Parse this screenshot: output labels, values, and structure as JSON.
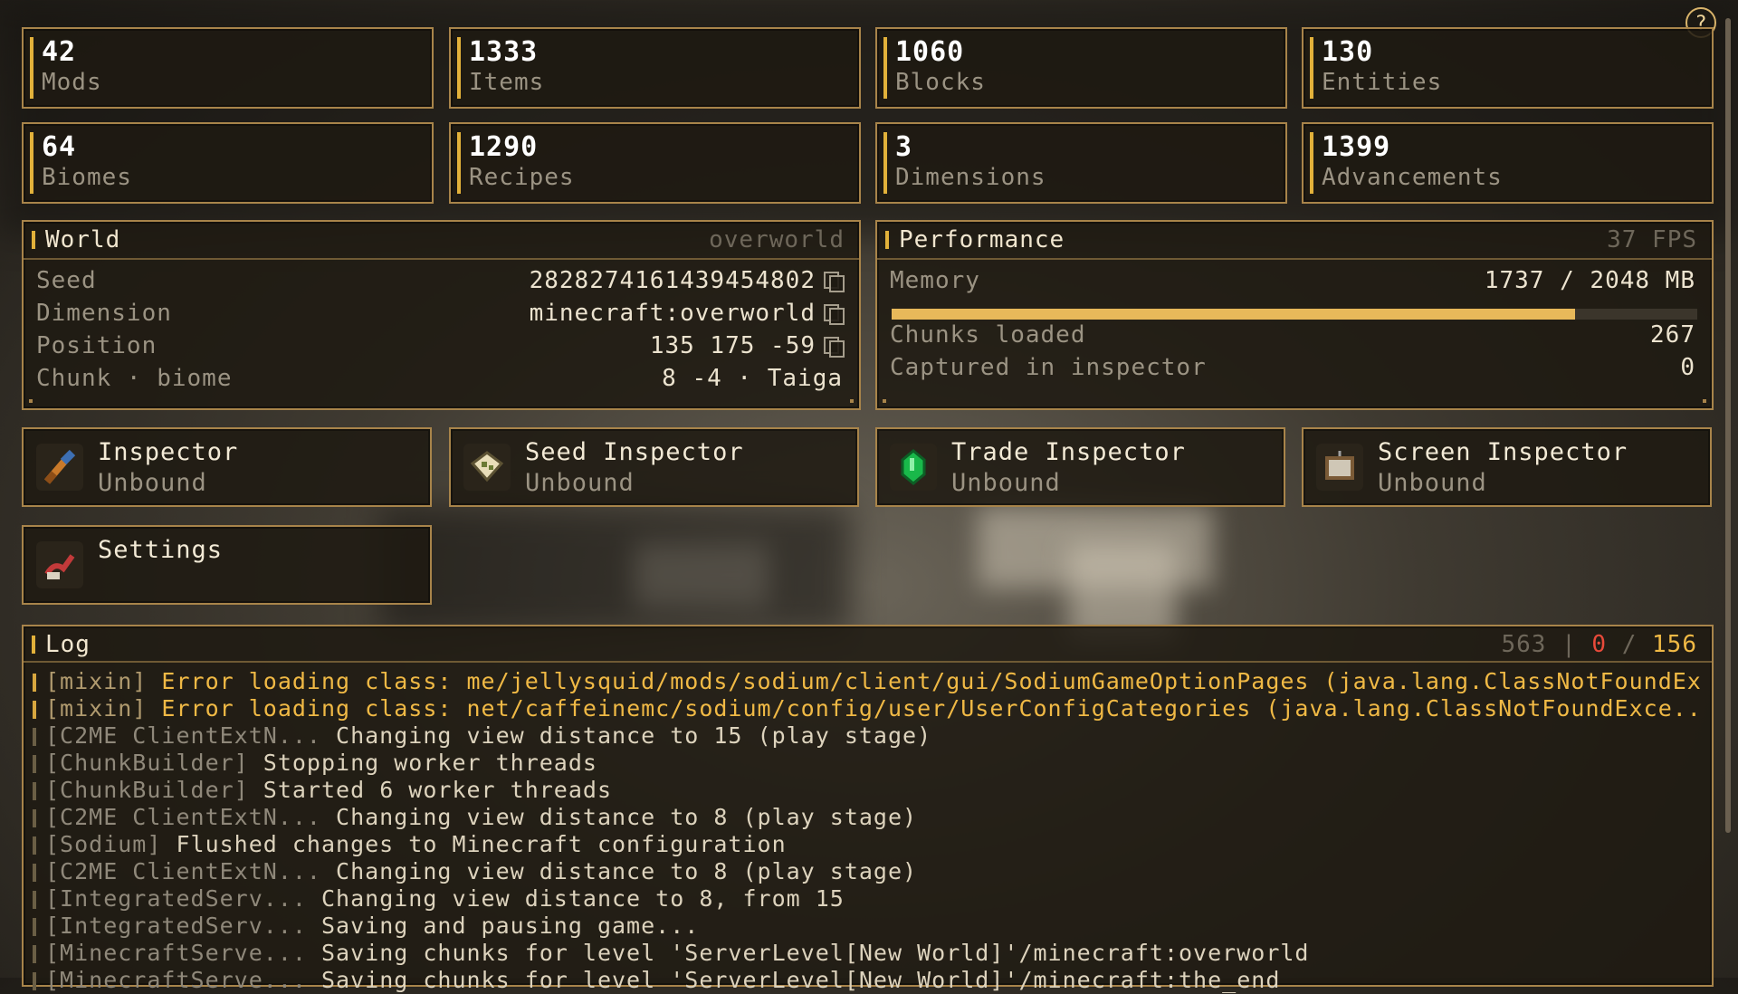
{
  "stats": [
    {
      "value": "42",
      "label": "Mods"
    },
    {
      "value": "1333",
      "label": "Items"
    },
    {
      "value": "1060",
      "label": "Blocks"
    },
    {
      "value": "130",
      "label": "Entities"
    },
    {
      "value": "64",
      "label": "Biomes"
    },
    {
      "value": "1290",
      "label": "Recipes"
    },
    {
      "value": "3",
      "label": "Dimensions"
    },
    {
      "value": "1399",
      "label": "Advancements"
    }
  ],
  "world": {
    "title": "World",
    "dimension_tag": "overworld",
    "rows": [
      {
        "key": "Seed",
        "value": "2828274161439454802"
      },
      {
        "key": "Dimension",
        "value": "minecraft:overworld"
      },
      {
        "key": "Position",
        "value": "135 175 -59"
      },
      {
        "key": "Chunk · biome",
        "value": "8 -4 · Taiga"
      }
    ]
  },
  "performance": {
    "title": "Performance",
    "fps": "37 FPS",
    "memory_label": "Memory",
    "memory_value": "1737 / 2048 MB",
    "memory_fraction": 0.848,
    "chunks_label": "Chunks loaded",
    "chunks_value": "267",
    "captured_label": "Captured in inspector",
    "captured_value": "0"
  },
  "tools": [
    {
      "name": "Inspector",
      "binding": "Unbound",
      "icon": "spyglass-icon"
    },
    {
      "name": "Seed Inspector",
      "binding": "Unbound",
      "icon": "map-icon"
    },
    {
      "name": "Trade Inspector",
      "binding": "Unbound",
      "icon": "emerald-icon"
    },
    {
      "name": "Screen Inspector",
      "binding": "Unbound",
      "icon": "painting-icon"
    },
    {
      "name": "Settings",
      "binding": "",
      "icon": "settings-icon"
    }
  ],
  "log": {
    "title": "Log",
    "total": "563",
    "separator": "|",
    "errors": "0",
    "slash": "/",
    "warnings": "156",
    "colors": {
      "errors": "#e84a3a",
      "warnings": "#f0b945"
    },
    "lines": [
      {
        "level": "warn",
        "source": "[mixin]",
        "text": "Error loading class: me/jellysquid/mods/sodium/client/gui/SodiumGameOptionPages (java.lang.ClassNotFoundEx..."
      },
      {
        "level": "warn",
        "source": "[mixin]",
        "text": "Error loading class: net/caffeinemc/sodium/config/user/UserConfigCategories (java.lang.ClassNotFoundExce..."
      },
      {
        "level": "info",
        "source": "[C2ME ClientExtN...",
        "text": "Changing view distance to 15 (play stage)"
      },
      {
        "level": "info",
        "source": "[ChunkBuilder]",
        "text": "Stopping worker threads"
      },
      {
        "level": "info",
        "source": "[ChunkBuilder]",
        "text": "Started 6 worker threads"
      },
      {
        "level": "info",
        "source": "[C2ME ClientExtN...",
        "text": "Changing view distance to 8 (play stage)"
      },
      {
        "level": "info",
        "source": "[Sodium]",
        "text": "Flushed changes to Minecraft configuration"
      },
      {
        "level": "info",
        "source": "[C2ME ClientExtN...",
        "text": "Changing view distance to 8 (play stage)"
      },
      {
        "level": "info",
        "source": "[IntegratedServ...",
        "text": "Changing view distance to 8, from 15"
      },
      {
        "level": "info",
        "source": "[IntegratedServ...",
        "text": "Saving and pausing game..."
      },
      {
        "level": "info",
        "source": "[MinecraftServe...",
        "text": "Saving chunks for level 'ServerLevel[New World]'/minecraft:overworld"
      },
      {
        "level": "info",
        "source": "[MinecraftServe...",
        "text": "Saving chunks for level 'ServerLevel[New World]'/minecraft:the_end"
      }
    ]
  },
  "help_label": "?"
}
